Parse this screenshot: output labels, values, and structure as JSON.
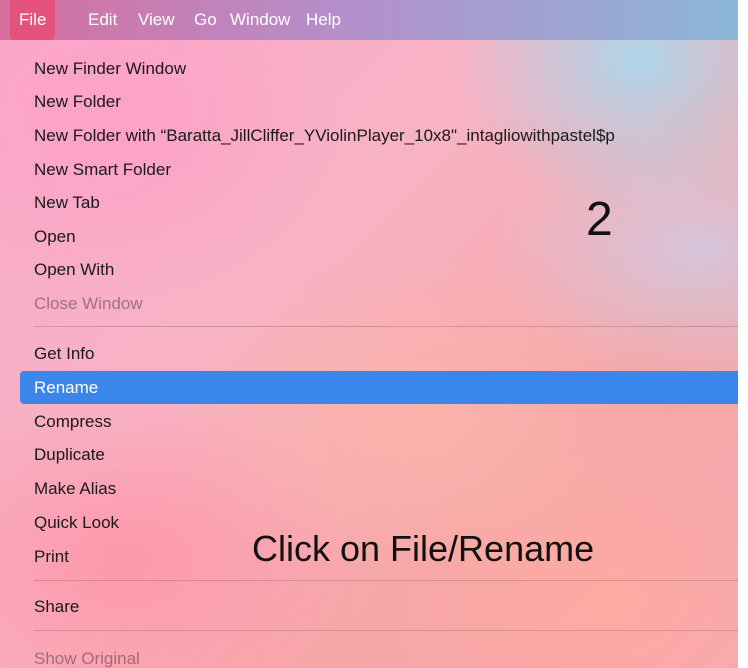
{
  "menubar": {
    "items": [
      {
        "label": "File"
      },
      {
        "label": "Edit"
      },
      {
        "label": "View"
      },
      {
        "label": "Go"
      },
      {
        "label": "Window"
      },
      {
        "label": "Help"
      }
    ]
  },
  "file_menu": {
    "items": [
      {
        "label": "New Finder Window"
      },
      {
        "label": "New Folder"
      },
      {
        "label": "New Folder with “Baratta_JillCliffer_YViolinPlayer_10x8\"_intagliowithpastel$p"
      },
      {
        "label": "New Smart Folder"
      },
      {
        "label": "New Tab"
      },
      {
        "label": "Open"
      },
      {
        "label": "Open With"
      },
      {
        "label": "Close Window"
      },
      {
        "label": "Get Info"
      },
      {
        "label": "Rename"
      },
      {
        "label": "Compress"
      },
      {
        "label": "Duplicate"
      },
      {
        "label": "Make Alias"
      },
      {
        "label": "Quick Look"
      },
      {
        "label": "Print"
      },
      {
        "label": "Share"
      },
      {
        "label": "Show Original"
      }
    ]
  },
  "overlay": {
    "step_number": "2",
    "instruction": "Click on File/Rename"
  },
  "colors": {
    "selection": "#3b86ea",
    "active_menu": "#e4537e"
  }
}
